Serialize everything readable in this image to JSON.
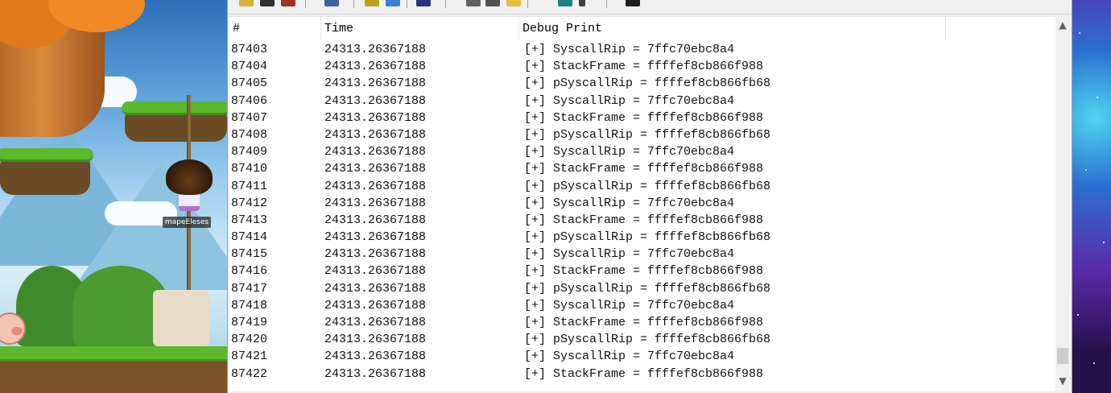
{
  "game": {
    "player_name": "mapeEleses"
  },
  "toolbar": {
    "buttons": [
      "open-icon",
      "save-icon",
      "save-as-icon",
      "find-icon",
      "filter-icon",
      "forward-icon",
      "capture-icon",
      "edit-icon",
      "copy-icon",
      "highlight-icon",
      "history-icon",
      "scroll-icon",
      "binoculars-icon"
    ]
  },
  "list": {
    "columns": [
      "#",
      "Time",
      "Debug Print"
    ],
    "rows": [
      {
        "num": "87403",
        "time": "24313.26367188",
        "msg": "[+] SyscallRip = 7ffc70ebc8a4"
      },
      {
        "num": "87404",
        "time": "24313.26367188",
        "msg": "[+] StackFrame = ffffef8cb866f988"
      },
      {
        "num": "87405",
        "time": "24313.26367188",
        "msg": "[+] pSyscallRip = ffffef8cb866fb68"
      },
      {
        "num": "87406",
        "time": "24313.26367188",
        "msg": "[+] SyscallRip = 7ffc70ebc8a4"
      },
      {
        "num": "87407",
        "time": "24313.26367188",
        "msg": "[+] StackFrame = ffffef8cb866f988"
      },
      {
        "num": "87408",
        "time": "24313.26367188",
        "msg": "[+] pSyscallRip = ffffef8cb866fb68"
      },
      {
        "num": "87409",
        "time": "24313.26367188",
        "msg": "[+] SyscallRip = 7ffc70ebc8a4"
      },
      {
        "num": "87410",
        "time": "24313.26367188",
        "msg": "[+] StackFrame = ffffef8cb866f988"
      },
      {
        "num": "87411",
        "time": "24313.26367188",
        "msg": "[+] pSyscallRip = ffffef8cb866fb68"
      },
      {
        "num": "87412",
        "time": "24313.26367188",
        "msg": "[+] SyscallRip = 7ffc70ebc8a4"
      },
      {
        "num": "87413",
        "time": "24313.26367188",
        "msg": "[+] StackFrame = ffffef8cb866f988"
      },
      {
        "num": "87414",
        "time": "24313.26367188",
        "msg": "[+] pSyscallRip = ffffef8cb866fb68"
      },
      {
        "num": "87415",
        "time": "24313.26367188",
        "msg": "[+] SyscallRip = 7ffc70ebc8a4"
      },
      {
        "num": "87416",
        "time": "24313.26367188",
        "msg": "[+] StackFrame = ffffef8cb866f988"
      },
      {
        "num": "87417",
        "time": "24313.26367188",
        "msg": "[+] pSyscallRip = ffffef8cb866fb68"
      },
      {
        "num": "87418",
        "time": "24313.26367188",
        "msg": "[+] SyscallRip = 7ffc70ebc8a4"
      },
      {
        "num": "87419",
        "time": "24313.26367188",
        "msg": "[+] StackFrame = ffffef8cb866f988"
      },
      {
        "num": "87420",
        "time": "24313.26367188",
        "msg": "[+] pSyscallRip = ffffef8cb866fb68"
      },
      {
        "num": "87421",
        "time": "24313.26367188",
        "msg": "[+] SyscallRip = 7ffc70ebc8a4"
      },
      {
        "num": "87422",
        "time": "24313.26367188",
        "msg": "[+] StackFrame = ffffef8cb866f988"
      }
    ]
  },
  "scrollbar": {
    "up": "▲",
    "down": "▼",
    "position": 0.97
  }
}
